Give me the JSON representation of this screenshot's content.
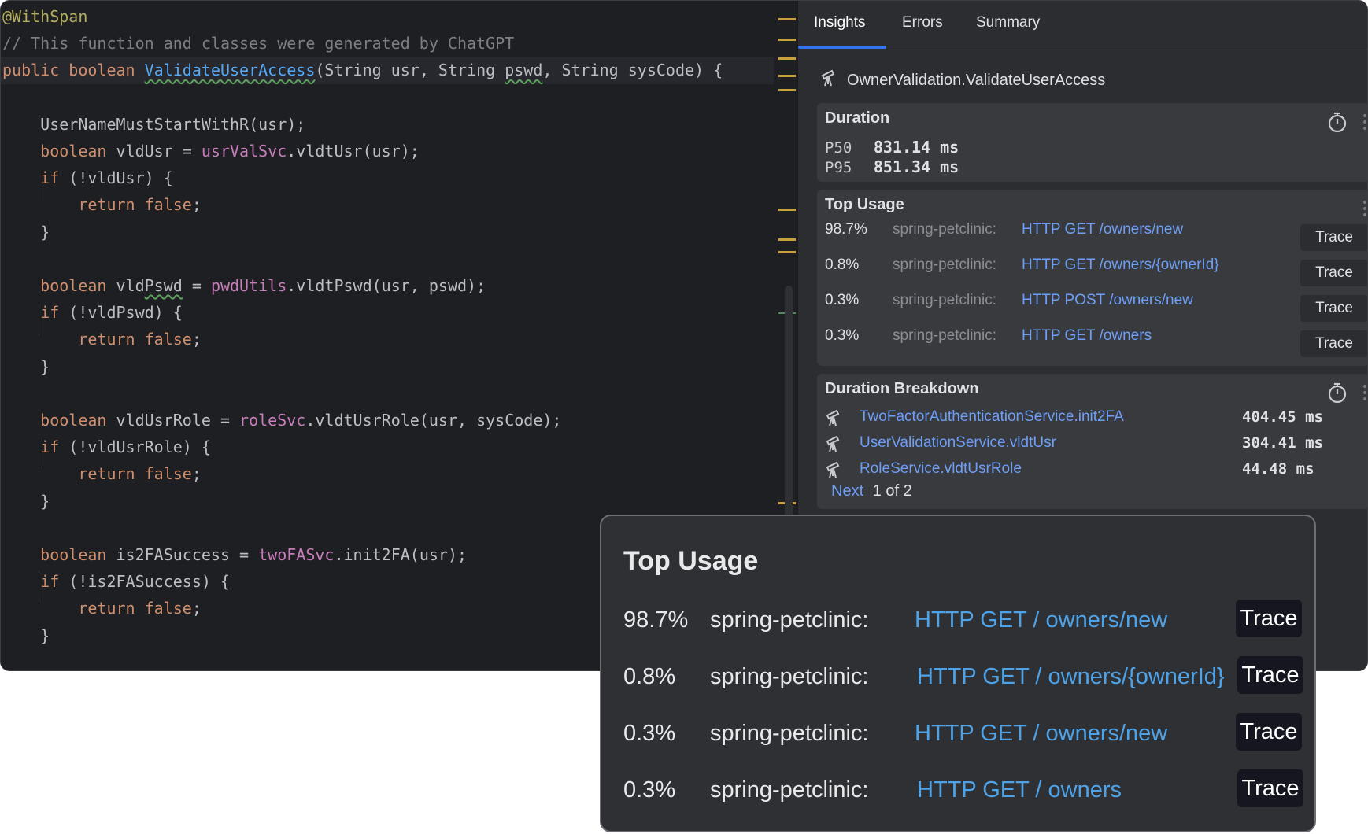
{
  "editor": {
    "lines": [
      {
        "parts": [
          {
            "t": "@WithSpan",
            "c": "ann"
          }
        ]
      },
      {
        "parts": [
          {
            "t": "// This function and classes were generated by ChatGPT",
            "c": "cm"
          }
        ]
      },
      {
        "parts": [
          {
            "t": "public boolean ",
            "c": "kw"
          },
          {
            "t": "ValidateUserAccess",
            "c": "fn-decl"
          },
          {
            "t": "(String usr, String ",
            "c": ""
          },
          {
            "t": "pswd",
            "c": "squig"
          },
          {
            "t": ", String sysCode) {",
            "c": ""
          }
        ]
      },
      {
        "parts": []
      },
      {
        "parts": [
          {
            "t": "    UserNameMustStartWithR(usr);",
            "c": ""
          }
        ]
      },
      {
        "parts": [
          {
            "t": "    ",
            "c": ""
          },
          {
            "t": "boolean",
            "c": "kw"
          },
          {
            "t": " vldUsr = ",
            "c": ""
          },
          {
            "t": "usrValSvc",
            "c": "field"
          },
          {
            "t": ".vldtUsr(usr);",
            "c": ""
          }
        ]
      },
      {
        "parts": [
          {
            "t": "    ",
            "c": ""
          },
          {
            "t": "if",
            "c": "kw"
          },
          {
            "t": " (!vldUsr) {",
            "c": ""
          }
        ]
      },
      {
        "parts": [
          {
            "t": "        ",
            "c": ""
          },
          {
            "t": "return false",
            "c": "kw"
          },
          {
            "t": ";",
            "c": ""
          }
        ]
      },
      {
        "parts": [
          {
            "t": "    }",
            "c": ""
          }
        ]
      },
      {
        "parts": []
      },
      {
        "parts": [
          {
            "t": "    ",
            "c": ""
          },
          {
            "t": "boolean",
            "c": "kw"
          },
          {
            "t": " vld",
            "c": ""
          },
          {
            "t": "Pswd",
            "c": "squig"
          },
          {
            "t": " = ",
            "c": ""
          },
          {
            "t": "pwdUtils",
            "c": "field"
          },
          {
            "t": ".vldtPswd(usr, pswd);",
            "c": ""
          }
        ]
      },
      {
        "parts": [
          {
            "t": "    ",
            "c": ""
          },
          {
            "t": "if",
            "c": "kw"
          },
          {
            "t": " (!vldPswd) {",
            "c": ""
          }
        ]
      },
      {
        "parts": [
          {
            "t": "        ",
            "c": ""
          },
          {
            "t": "return false",
            "c": "kw"
          },
          {
            "t": ";",
            "c": ""
          }
        ]
      },
      {
        "parts": [
          {
            "t": "    }",
            "c": ""
          }
        ]
      },
      {
        "parts": []
      },
      {
        "parts": [
          {
            "t": "    ",
            "c": ""
          },
          {
            "t": "boolean",
            "c": "kw"
          },
          {
            "t": " vldUsrRole = ",
            "c": ""
          },
          {
            "t": "roleSvc",
            "c": "field"
          },
          {
            "t": ".vldtUsrRole(usr, sysCode);",
            "c": ""
          }
        ]
      },
      {
        "parts": [
          {
            "t": "    ",
            "c": ""
          },
          {
            "t": "if",
            "c": "kw"
          },
          {
            "t": " (!vldUsrRole) {",
            "c": ""
          }
        ]
      },
      {
        "parts": [
          {
            "t": "        ",
            "c": ""
          },
          {
            "t": "return false",
            "c": "kw"
          },
          {
            "t": ";",
            "c": ""
          }
        ]
      },
      {
        "parts": [
          {
            "t": "    }",
            "c": ""
          }
        ]
      },
      {
        "parts": []
      },
      {
        "parts": [
          {
            "t": "    ",
            "c": ""
          },
          {
            "t": "boolean",
            "c": "kw"
          },
          {
            "t": " is2FASuccess = ",
            "c": ""
          },
          {
            "t": "twoFASvc",
            "c": "field"
          },
          {
            "t": ".init2FA(usr);",
            "c": ""
          }
        ]
      },
      {
        "parts": [
          {
            "t": "    ",
            "c": ""
          },
          {
            "t": "if",
            "c": "kw"
          },
          {
            "t": " (!is2FASuccess) {",
            "c": ""
          }
        ]
      },
      {
        "parts": [
          {
            "t": "        ",
            "c": ""
          },
          {
            "t": "return false",
            "c": "kw"
          },
          {
            "t": ";",
            "c": ""
          }
        ]
      },
      {
        "parts": [
          {
            "t": "    }",
            "c": ""
          }
        ]
      }
    ]
  },
  "panel": {
    "tabs": [
      {
        "label": "Insights",
        "active": true
      },
      {
        "label": "Errors",
        "active": false
      },
      {
        "label": "Summary",
        "active": false
      }
    ],
    "span_name": "OwnerValidation.ValidateUserAccess",
    "duration": {
      "title": "Duration",
      "p50_label": "P50",
      "p50_value": "831.14 ms",
      "p95_label": "P95",
      "p95_value": "851.34 ms"
    },
    "top_usage": {
      "title": "Top Usage",
      "rows": [
        {
          "pct": "98.7%",
          "service": "spring-petclinic:",
          "endpoint": "HTTP GET /owners/new",
          "action": "Trace"
        },
        {
          "pct": "0.8%",
          "service": "spring-petclinic:",
          "endpoint": "HTTP GET /owners/{ownerId}",
          "action": "Trace"
        },
        {
          "pct": "0.3%",
          "service": "spring-petclinic:",
          "endpoint": "HTTP POST /owners/new",
          "action": "Trace"
        },
        {
          "pct": "0.3%",
          "service": "spring-petclinic:",
          "endpoint": "HTTP GET /owners",
          "action": "Trace"
        }
      ]
    },
    "breakdown": {
      "title": "Duration Breakdown",
      "rows": [
        {
          "name": "TwoFactorAuthenticationService.init2FA",
          "value": "404.45 ms"
        },
        {
          "name": "UserValidationService.vldtUsr",
          "value": "304.41 ms"
        },
        {
          "name": "RoleService.vldtUsrRole",
          "value": "44.48 ms"
        }
      ],
      "pager_next": "Next",
      "pager_status": "1 of 2"
    }
  },
  "popup": {
    "title": "Top Usage",
    "rows": [
      {
        "pct": "98.7%",
        "service": "spring-petclinic:",
        "endpoint": "HTTP GET / owners/new",
        "action": "Trace"
      },
      {
        "pct": "0.8%",
        "service": "spring-petclinic:",
        "endpoint": "HTTP GET / owners/{ownerId}",
        "action": "Trace"
      },
      {
        "pct": "0.3%",
        "service": "spring-petclinic:",
        "endpoint": "HTTP GET / owners/new",
        "action": "Trace"
      },
      {
        "pct": "0.3%",
        "service": "spring-petclinic:",
        "endpoint": "HTTP GET / owners",
        "action": "Trace"
      }
    ]
  },
  "colors": {
    "accent": "#3574f0",
    "link": "#6e9ef5",
    "popup_link": "#4ea3e8",
    "editor_bg": "#1e1f22",
    "panel_bg": "#2b2d30"
  },
  "icons": {
    "span": "telescope-icon",
    "timer": "stopwatch-icon",
    "menu": "kebab-menu-icon"
  }
}
